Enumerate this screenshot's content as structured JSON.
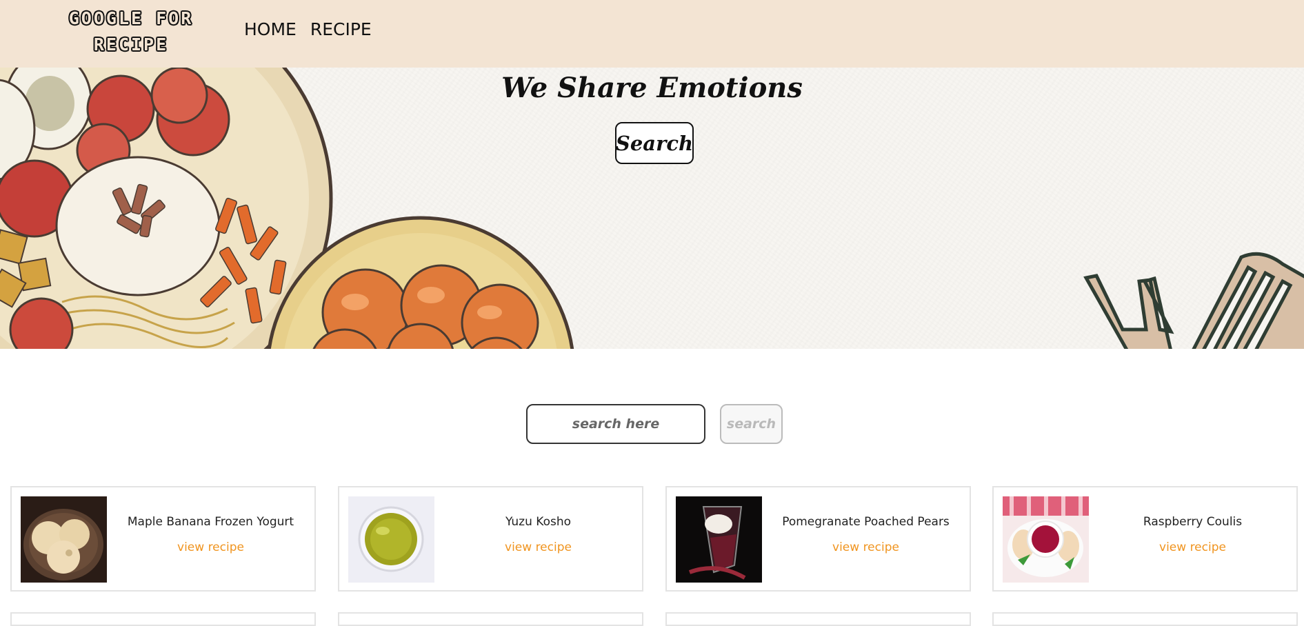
{
  "navbar": {
    "brand": "GOOGLE FOR RECIPE",
    "links": [
      "HOME",
      "RECIPE"
    ]
  },
  "hero": {
    "title": "We Share Emotions",
    "button_label": "Search"
  },
  "search": {
    "placeholder": "search here",
    "button_label": "search"
  },
  "recipes": [
    {
      "title": "Maple Banana Frozen Yogurt",
      "link": "view recipe",
      "image": "frozen-yogurt-photo"
    },
    {
      "title": "Yuzu Kosho",
      "link": "view recipe",
      "image": "yuzu-kosho-photo"
    },
    {
      "title": "Pomegranate Poached Pears",
      "link": "view recipe",
      "image": "poached-pears-photo"
    },
    {
      "title": "Raspberry Coulis",
      "link": "view recipe",
      "image": "raspberry-coulis-photo"
    }
  ],
  "colors": {
    "navbar_bg": "#f3e4d3",
    "link_accent": "#f0941f",
    "card_border": "#e3e3e3"
  }
}
